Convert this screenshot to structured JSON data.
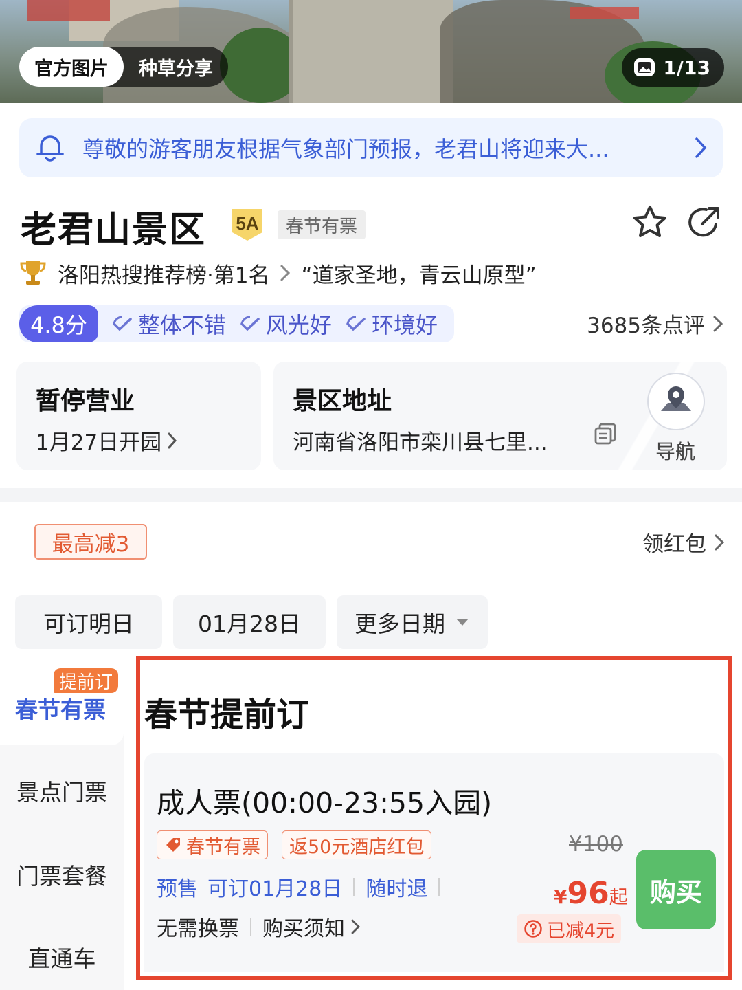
{
  "hero": {
    "tab_official": "官方图片",
    "tab_share": "种草分享",
    "photo_counter": "1/13"
  },
  "notice": {
    "text": "尊敬的游客朋友根据气象部门预报，老君山将迎来大..."
  },
  "attraction": {
    "name": "老君山景区",
    "level_badge": "5A",
    "tag": "春节有票",
    "rank_text": "洛阳热搜推荐榜·第1名",
    "quote": "“道家圣地，青云山原型”",
    "rating": "4.8分",
    "rating_tags": [
      "整体不错",
      "风光好",
      "环境好"
    ],
    "review_count": "3685条点评"
  },
  "info": {
    "status_title": "暂停营业",
    "status_sub": "1月27日开园",
    "address_title": "景区地址",
    "address": "河南省洛阳市栾川县七里...",
    "nav_label": "导航"
  },
  "promo": {
    "discount": "最高减3",
    "redpack": "领红包"
  },
  "dates": [
    "可订明日",
    "01月28日",
    "更多日期"
  ],
  "side_nav": {
    "flag": "提前订",
    "items": [
      "春节有票",
      "景点门票",
      "门票套餐",
      "直通车"
    ]
  },
  "panel": {
    "title": "春节提前订",
    "product_name": "成人票(00:00-23:55入园)",
    "tag1": "春节有票",
    "tag2": "返50元酒店红包",
    "presale": "预售",
    "book_date": "可订01月28日",
    "refund": "随时退",
    "no_exchange": "无需换票",
    "notice": "购买须知",
    "old_price": "¥100",
    "currency": "¥",
    "price": "96",
    "price_suffix": "起",
    "saved": "已减4元",
    "buy": "购买"
  },
  "colors": {
    "accent_blue": "#3b5ed6",
    "rating_purple": "#5b5fe8",
    "price_red": "#e5452f",
    "buy_green": "#5abe6a",
    "highlight_border": "#e5452f"
  }
}
